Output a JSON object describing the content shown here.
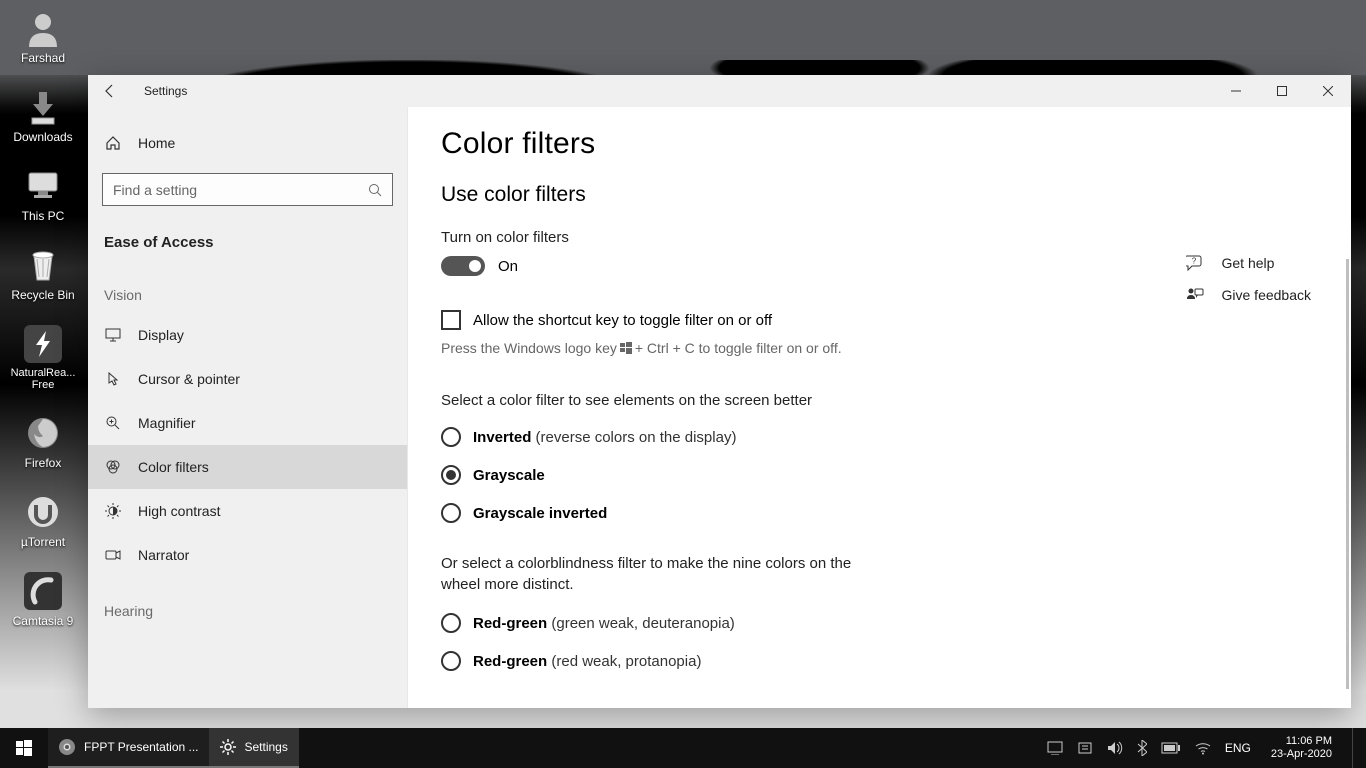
{
  "desktop": {
    "icons": [
      "Farshad",
      "Downloads",
      "This PC",
      "Recycle Bin",
      "NaturalRea... Free",
      "Firefox",
      "µTorrent",
      "Camtasia 9"
    ]
  },
  "window": {
    "title": "Settings",
    "home": "Home",
    "search_placeholder": "Find a setting",
    "category": "Ease of Access",
    "section_vision": "Vision",
    "section_hearing": "Hearing",
    "nav": {
      "display": "Display",
      "cursor": "Cursor & pointer",
      "magnifier": "Magnifier",
      "color_filters": "Color filters",
      "high_contrast": "High contrast",
      "narrator": "Narrator"
    }
  },
  "content": {
    "heading": "Color filters",
    "sub_heading": "Use color filters",
    "toggle_label": "Turn on color filters",
    "toggle_state": "On",
    "checkbox_label": "Allow the shortcut key to toggle filter on or off",
    "hint1": "Press the Windows logo key",
    "hint2": "+ Ctrl + C to toggle filter on or off.",
    "prompt1": "Select a color filter to see elements on the screen better",
    "prompt2": "Or select a colorblindness filter to make the nine colors on the wheel more distinct.",
    "radios": {
      "inverted": "Inverted",
      "inverted_desc": " (reverse colors on the display)",
      "grayscale": "Grayscale",
      "grayscale_inv": "Grayscale inverted",
      "rg1": "Red-green",
      "rg1_desc": " (green weak, deuteranopia)",
      "rg2": "Red-green",
      "rg2_desc": " (red weak, protanopia)"
    },
    "side": {
      "help": "Get help",
      "feedback": "Give feedback"
    }
  },
  "taskbar": {
    "chrome": "FPPT Presentation ...",
    "settings": "Settings",
    "lang": "ENG",
    "time": "11:06 PM",
    "date": "23-Apr-2020"
  }
}
